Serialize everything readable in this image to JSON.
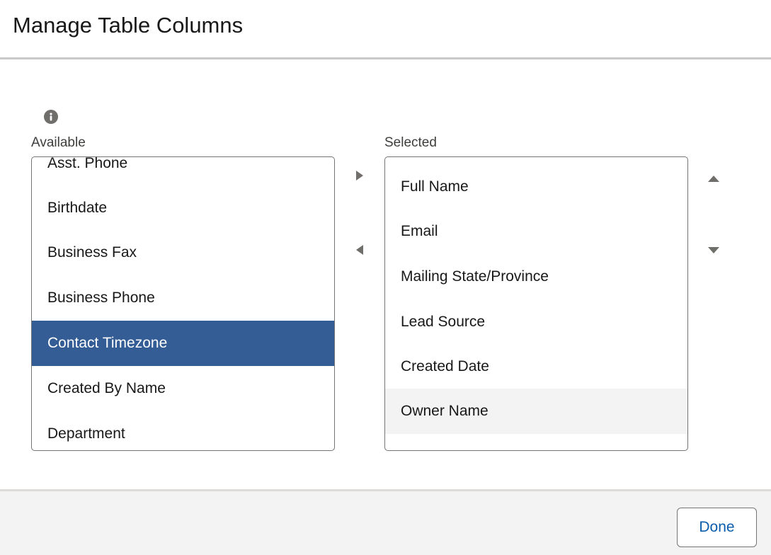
{
  "dialog": {
    "title": "Manage Table Columns"
  },
  "available": {
    "label": "Available",
    "options": [
      {
        "label": "Asst. Phone",
        "state": "normal"
      },
      {
        "label": "Birthdate",
        "state": "normal"
      },
      {
        "label": "Business Fax",
        "state": "normal"
      },
      {
        "label": "Business Phone",
        "state": "normal"
      },
      {
        "label": "Contact Timezone",
        "state": "selected"
      },
      {
        "label": "Created By Name",
        "state": "normal"
      },
      {
        "label": "Department",
        "state": "normal"
      }
    ]
  },
  "selected": {
    "label": "Selected",
    "options": [
      {
        "label": "Full Name",
        "state": "normal"
      },
      {
        "label": "Email",
        "state": "normal"
      },
      {
        "label": "Mailing State/Province",
        "state": "normal"
      },
      {
        "label": "Lead Source",
        "state": "normal"
      },
      {
        "label": "Created Date",
        "state": "normal"
      },
      {
        "label": "Owner Name",
        "state": "hover"
      }
    ]
  },
  "icons": {
    "info": "info-icon",
    "move_right": "right-triangle-icon",
    "move_left": "left-triangle-icon",
    "move_up": "up-triangle-icon",
    "move_down": "down-triangle-icon"
  },
  "colors": {
    "selected_option_bg": "#345d95",
    "hover_option_bg": "#f3f3f3",
    "done_text": "#0b5cab",
    "icon_gray": "#706e6b"
  },
  "footer": {
    "done_label": "Done"
  }
}
